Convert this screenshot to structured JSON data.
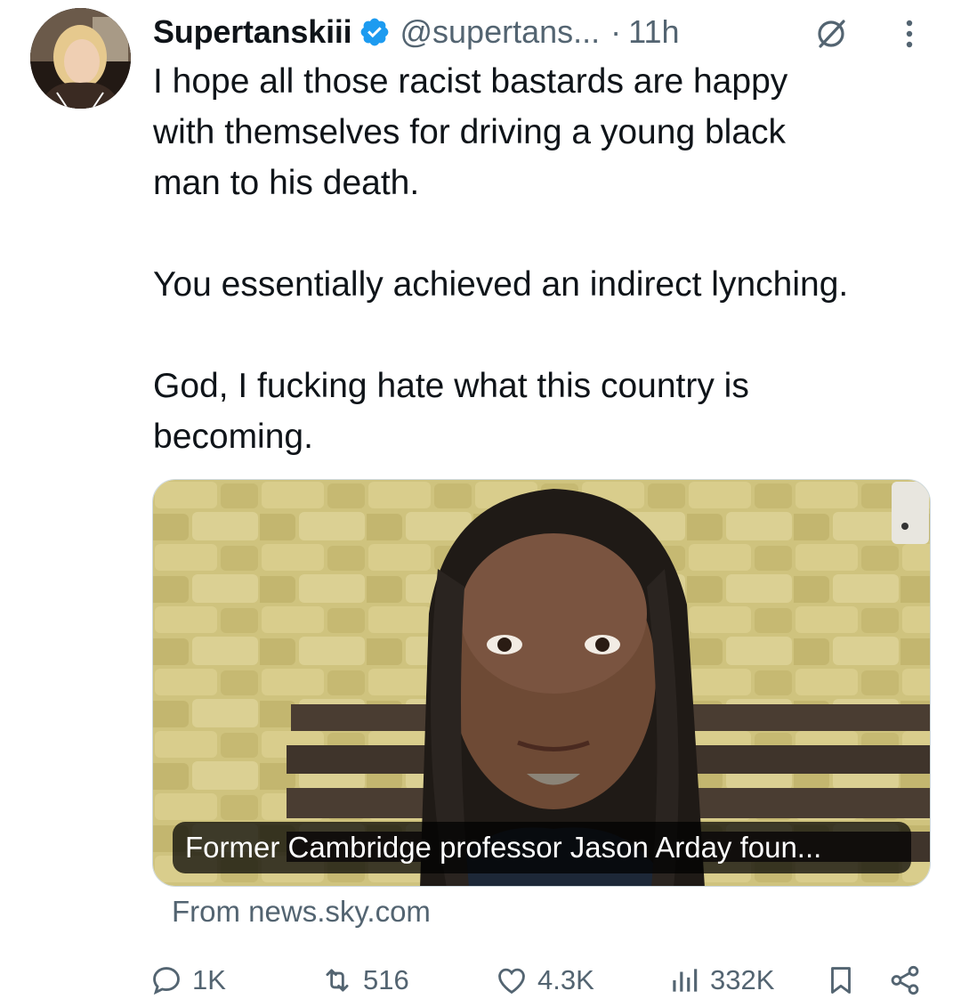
{
  "author": {
    "display_name": "Supertanskiii",
    "handle": "@supertans...",
    "separator": "·",
    "time": "11h",
    "verified": true
  },
  "body": {
    "paragraphs": [
      [
        "I hope all those racist bastards are happy",
        "with themselves for driving a young black",
        "man to his death."
      ],
      [
        "You essentially achieved an indirect lynching."
      ],
      [
        "God, I fucking hate what this country is",
        "becoming."
      ]
    ]
  },
  "card": {
    "headline": "Former Cambridge professor Jason Arday foun...",
    "source": "From news.sky.com"
  },
  "actions": {
    "replies": "1K",
    "reposts": "516",
    "likes": "4.3K",
    "views": "332K"
  },
  "icons": {
    "verified": "verified-badge-icon",
    "grok": "grok-icon",
    "more": "more-vertical-icon",
    "reply": "reply-icon",
    "repost": "repost-icon",
    "like": "heart-icon",
    "views": "views-icon",
    "bookmark": "bookmark-icon",
    "share": "share-icon"
  },
  "colors": {
    "text": "#0f1419",
    "secondary": "#536471",
    "verified": "#1d9bf0"
  }
}
